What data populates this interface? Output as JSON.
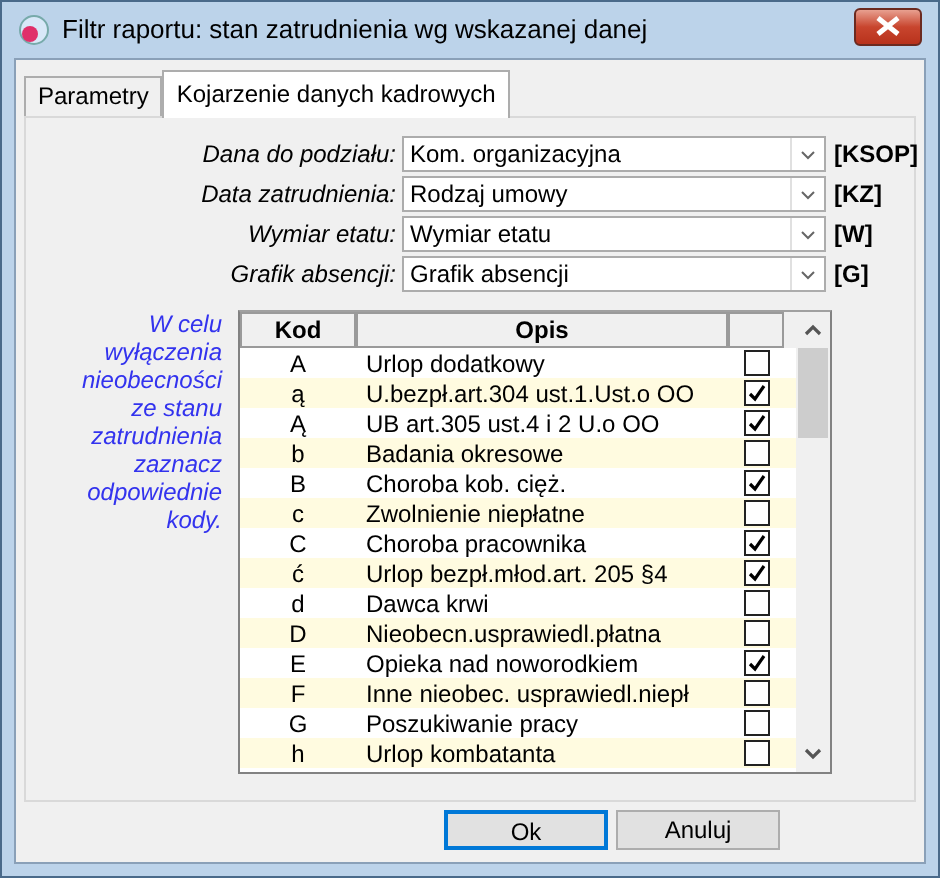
{
  "window": {
    "title": "Filtr raportu: stan zatrudnienia wg wskazanej danej"
  },
  "tabs": [
    {
      "label": "Parametry",
      "selected": false
    },
    {
      "label": "Kojarzenie danych kadrowych",
      "selected": true
    }
  ],
  "fields": [
    {
      "label": "Dana do podziału:",
      "value": "Kom. organizacyjna",
      "code": "[KSOP]"
    },
    {
      "label": "Data zatrudnienia:",
      "value": "Rodzaj umowy",
      "code": "[KZ]"
    },
    {
      "label": "Wymiar etatu:",
      "value": "Wymiar etatu",
      "code": "[W]"
    },
    {
      "label": "Grafik absencji:",
      "value": "Grafik absencji",
      "code": "[G]"
    }
  ],
  "note": "W celu wyłączenia nieobecności ze stanu zatrudnienia zaznacz odpowiednie kody.",
  "table": {
    "columns": [
      "Kod",
      "Opis"
    ],
    "rows": [
      {
        "code": "A",
        "description": "Urlop dodatkowy",
        "checked": false
      },
      {
        "code": "ą",
        "description": "U.bezpł.art.304 ust.1.Ust.o OO",
        "checked": true
      },
      {
        "code": "Ą",
        "description": "UB art.305 ust.4 i 2 U.o OO",
        "checked": true
      },
      {
        "code": "b",
        "description": "Badania okresowe",
        "checked": false
      },
      {
        "code": "B",
        "description": "Choroba kob. cięż.",
        "checked": true
      },
      {
        "code": "c",
        "description": "Zwolnienie niepłatne",
        "checked": false
      },
      {
        "code": "C",
        "description": "Choroba pracownika",
        "checked": true
      },
      {
        "code": "ć",
        "description": "Urlop bezpł.młod.art. 205 §4",
        "checked": true
      },
      {
        "code": "d",
        "description": "Dawca krwi",
        "checked": false
      },
      {
        "code": "D",
        "description": "Nieobecn.usprawiedl.płatna",
        "checked": false
      },
      {
        "code": "E",
        "description": "Opieka nad noworodkiem",
        "checked": true
      },
      {
        "code": "F",
        "description": "Inne nieobec. usprawiedl.niepł",
        "checked": false
      },
      {
        "code": "G",
        "description": "Poszukiwanie pracy",
        "checked": false
      },
      {
        "code": "h",
        "description": "Urlop kombatanta",
        "checked": false
      }
    ]
  },
  "buttons": [
    {
      "label": "Ok",
      "default": true
    },
    {
      "label": "Anuluj",
      "default": false
    }
  ]
}
